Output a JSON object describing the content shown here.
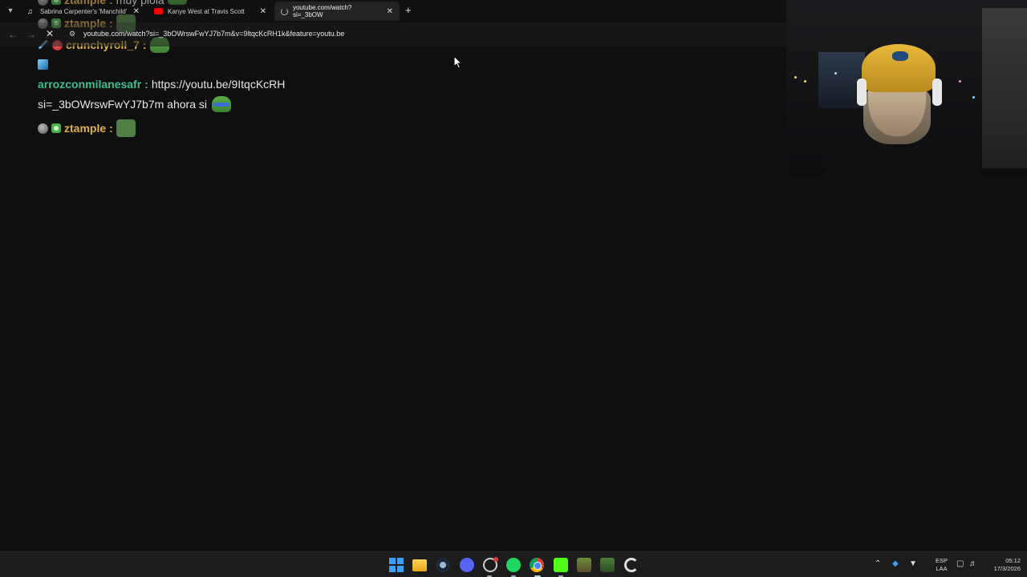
{
  "chat": {
    "top_partial": {
      "username": "ztample",
      "message": "muy piola"
    },
    "lines": [
      {
        "username": "ztample",
        "suffix": ":"
      },
      {
        "username": "crunchyroll_7",
        "suffix": ":"
      },
      {
        "username": "arrozconmilanesafr",
        "suffix": ":",
        "message": "https://youtu.be/9ItqcKcRH",
        "message_line2": "si=_3bOWrswFwYJ7b7m ahora si"
      },
      {
        "username": "ztample",
        "suffix": ":"
      }
    ],
    "colors": {
      "ztample": "#e3b04b",
      "crunchyroll_7": "#e3b04b",
      "arrozconmilanesafr": "#3fc08f"
    }
  },
  "browser": {
    "tabs": [
      {
        "title": "Sabrina Carpenter's 'Manchild'",
        "icon": "tiktok-icon"
      },
      {
        "title": "Kanye West at Travis Scott",
        "icon": "youtube-icon"
      },
      {
        "title": "youtube.com/watch?si=_3bOW",
        "icon": "loading-icon",
        "active": true
      }
    ],
    "url": "youtube.com/watch?si=_3bOWrswFwYJ7b7m&v=9ltqcKcRH1k&feature=youtu.be"
  },
  "taskbar": {
    "apps": [
      "windows-start",
      "file-explorer",
      "steam",
      "discord",
      "obs",
      "spotify",
      "chrome",
      "kick",
      "minecraft",
      "minecraft-launcher",
      "ccleaner"
    ],
    "language_top": "ESP",
    "language_bottom": "LAA",
    "time": "05:12",
    "date": "17/3/2026"
  }
}
